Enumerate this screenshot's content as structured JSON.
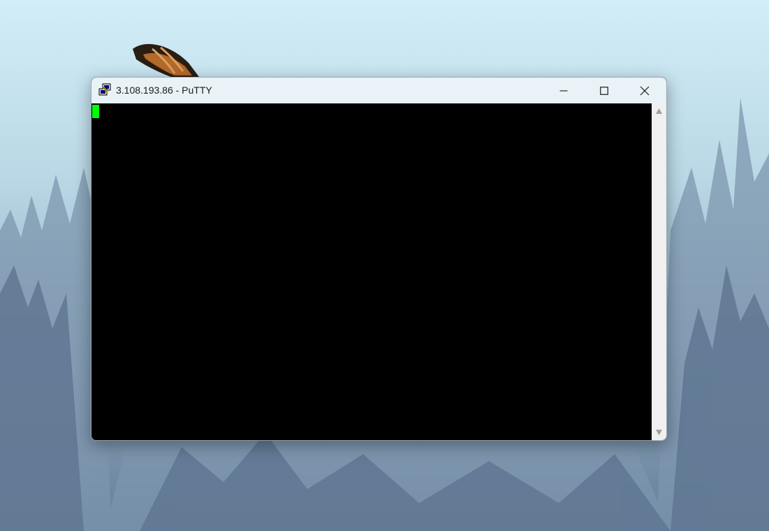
{
  "window": {
    "title": "3.108.193.86 - PuTTY",
    "app_icon": "putty-icon",
    "buttons": {
      "minimize_icon": "minimize-icon",
      "maximize_icon": "maximize-icon",
      "close_icon": "close-icon"
    }
  },
  "terminal": {
    "background": "#000000",
    "cursor_color": "#00ff00",
    "text": ""
  },
  "scrollbar": {
    "up_icon": "scroll-up-arrow-icon",
    "down_icon": "scroll-down-arrow-icon"
  }
}
